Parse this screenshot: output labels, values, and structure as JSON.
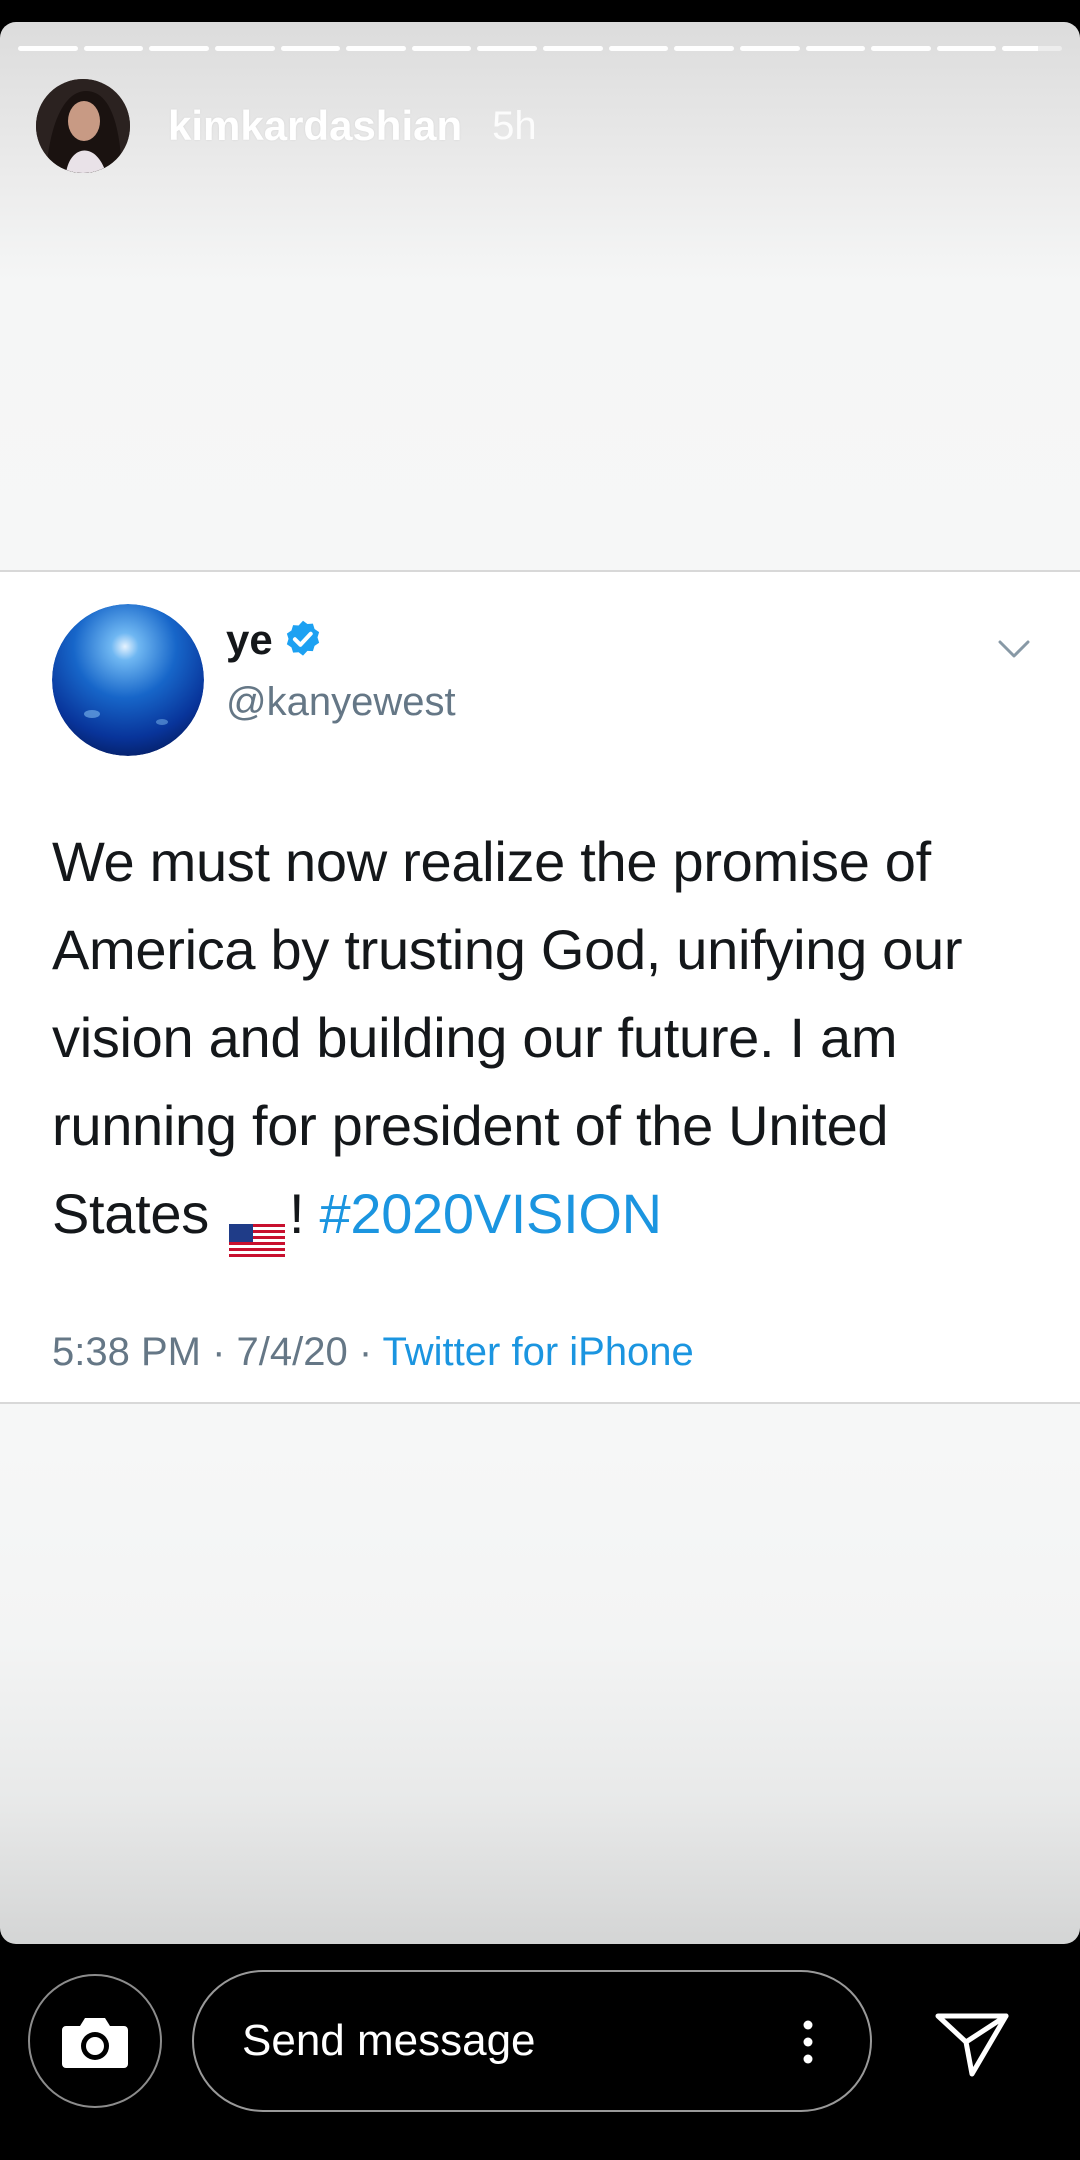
{
  "story": {
    "username": "kimkardashian",
    "time": "5h",
    "segment_count": 16
  },
  "tweet": {
    "name": "ye",
    "handle": "@kanyewest",
    "text_main": "We must now realize the promise of America by trusting God, unifying our vision and building our future. I am running for president of the United States",
    "flag_emoji": "🇺🇸",
    "exclaim": "!",
    "hashtag": "#2020VISION",
    "timestamp": "5:38 PM · 7/4/20 ·",
    "source": "Twitter for iPhone",
    "link_color": "#1b95e0"
  },
  "bottom_bar": {
    "message_placeholder": "Send message"
  },
  "icons": {
    "verified": "verified-badge-icon",
    "chevron": "chevron-down-icon",
    "camera": "camera-icon",
    "more": "more-vertical-icon",
    "send": "send-icon"
  }
}
